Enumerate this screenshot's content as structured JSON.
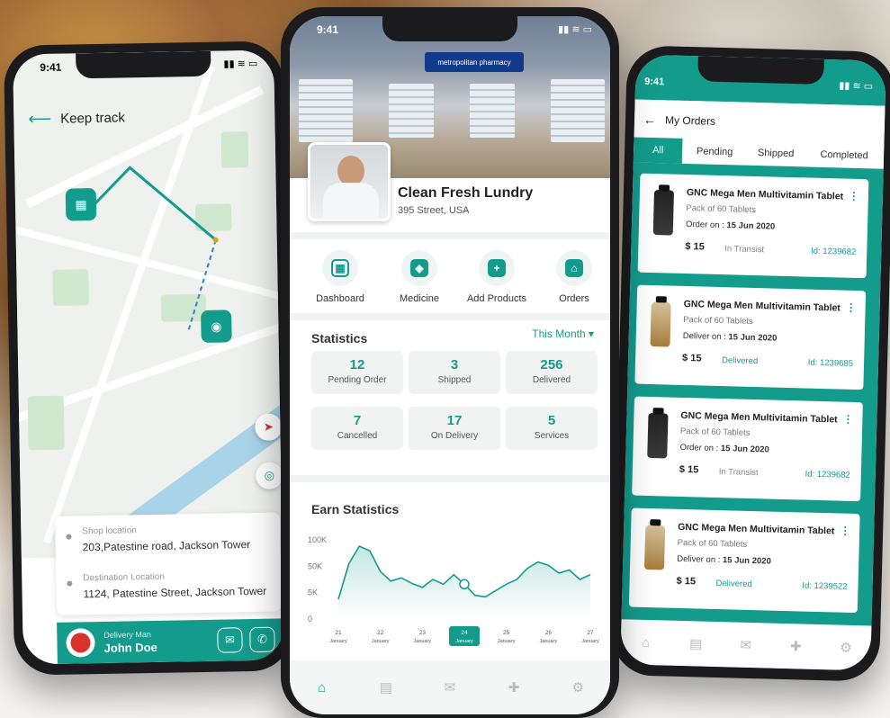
{
  "left": {
    "time": "9:41",
    "title": "Keep track",
    "shop_label": "Shop location",
    "shop_value": "203,Patestine road, Jackson Tower",
    "dest_label": "Destination Location",
    "dest_value": "1124, Patestine Street, Jackson Tower",
    "driver_role": "Delivery Man",
    "driver_name": "John Doe"
  },
  "center": {
    "time": "9:41",
    "banner_text": "metropolitan pharmacy",
    "shop_name": "Clean Fresh Lundry",
    "shop_address": "395 Street, USA",
    "menu": [
      {
        "label": "Dashboard",
        "icon": "dashboard-icon"
      },
      {
        "label": "Medicine",
        "icon": "medicine-box-icon"
      },
      {
        "label": "Add Products",
        "icon": "add-product-icon"
      },
      {
        "label": "Orders",
        "icon": "cart-icon"
      }
    ],
    "statistics_title": "Statistics",
    "period": "This Month",
    "stats": [
      {
        "value": "12",
        "label": "Pending Order"
      },
      {
        "value": "3",
        "label": "Shipped"
      },
      {
        "value": "256",
        "label": "Delivered"
      },
      {
        "value": "7",
        "label": "Cancelled"
      },
      {
        "value": "17",
        "label": "On Delivery"
      },
      {
        "value": "5",
        "label": "Services"
      }
    ],
    "earn_title": "Earn Statistics"
  },
  "right": {
    "time": "9:41",
    "title": "My Orders",
    "tabs": [
      "All",
      "Pending",
      "Shipped",
      "Completed"
    ],
    "orders": [
      {
        "name": "GNC Mega Men Multivitamin Tablet",
        "pack": "Pack of 60 Tablets",
        "date_label": "Order on : ",
        "date": "15 Jun 2020",
        "price": "$ 15",
        "status": "In Transist",
        "id": "Id: 1239682",
        "bottle": "dark"
      },
      {
        "name": "GNC Mega Men Multivitamin Tablet",
        "pack": "Pack of 60 Tablets",
        "date_label": "Deliver on : ",
        "date": "15 Jun 2020",
        "price": "$ 15",
        "status": "Delivered",
        "id": "Id: 1239685",
        "bottle": "amber"
      },
      {
        "name": "GNC Mega Men Multivitamin Tablet",
        "pack": "Pack of 60 Tablets",
        "date_label": "Order on : ",
        "date": "15 Jun 2020",
        "price": "$ 15",
        "status": "In Transist",
        "id": "Id: 1239682",
        "bottle": "dark"
      },
      {
        "name": "GNC Mega Men Multivitamin Tablet",
        "pack": "Pack of 60 Tablets",
        "date_label": "Deliver on : ",
        "date": "15 Jun 2020",
        "price": "$ 15",
        "status": "Delivered",
        "id": "Id: 1239522",
        "bottle": "amber"
      }
    ]
  },
  "colors": {
    "accent": "#139b8c",
    "transit": "#888888",
    "delivered": "#139b8c"
  },
  "chart_data": {
    "type": "area",
    "title": "Earn Statistics",
    "yticks": [
      "100K",
      "50K",
      "5K",
      "0"
    ],
    "categories": [
      "21 January",
      "22 January",
      "23 January",
      "24 January",
      "25 January",
      "26 January",
      "27 January"
    ],
    "highlight": "24 January",
    "series": [
      {
        "values": [
          25,
          70,
          92,
          86,
          60,
          48,
          52,
          45,
          40,
          50,
          44,
          56,
          44,
          30,
          28,
          36,
          44,
          50,
          64,
          72,
          68,
          58,
          62,
          50,
          56
        ]
      }
    ],
    "ylim": [
      0,
      100
    ]
  }
}
